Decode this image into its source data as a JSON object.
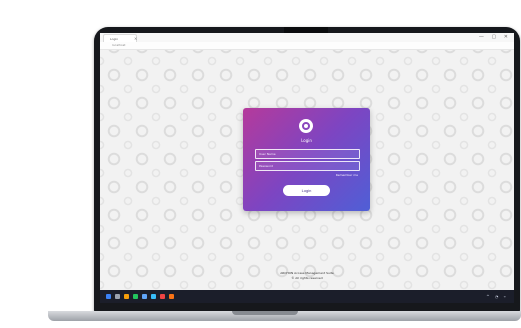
{
  "browser": {
    "tab_title": "Login",
    "tab_close_icon": "close-icon",
    "url": "localhost",
    "window_controls": "— ▢ ✕"
  },
  "login": {
    "logo_icon": "app-logo-icon",
    "title": "Login",
    "username_placeholder": "User Name",
    "password_placeholder": "Password",
    "remember_label": "Remember me",
    "login_button_label": "Login"
  },
  "footer": {
    "line1": "ARCHON Access Management Suite",
    "line2": "© All rights reserved"
  },
  "taskbar": {
    "icons": [
      {
        "name": "start-icon",
        "color": "#3b82f6"
      },
      {
        "name": "search-icon",
        "color": "#9ca3af"
      },
      {
        "name": "file-explorer-icon",
        "color": "#f59e0b"
      },
      {
        "name": "edge-icon",
        "color": "#22c55e"
      },
      {
        "name": "store-icon",
        "color": "#60a5fa"
      },
      {
        "name": "mail-icon",
        "color": "#38bdf8"
      },
      {
        "name": "chrome-icon",
        "color": "#ef4444"
      },
      {
        "name": "app-icon",
        "color": "#f97316"
      }
    ],
    "tray_text": "^ ◔ ⌁"
  },
  "colors": {
    "card_gradient_start": "#b53a9b",
    "card_gradient_end": "#4f5fd6",
    "taskbar": "#1b1e2a"
  }
}
